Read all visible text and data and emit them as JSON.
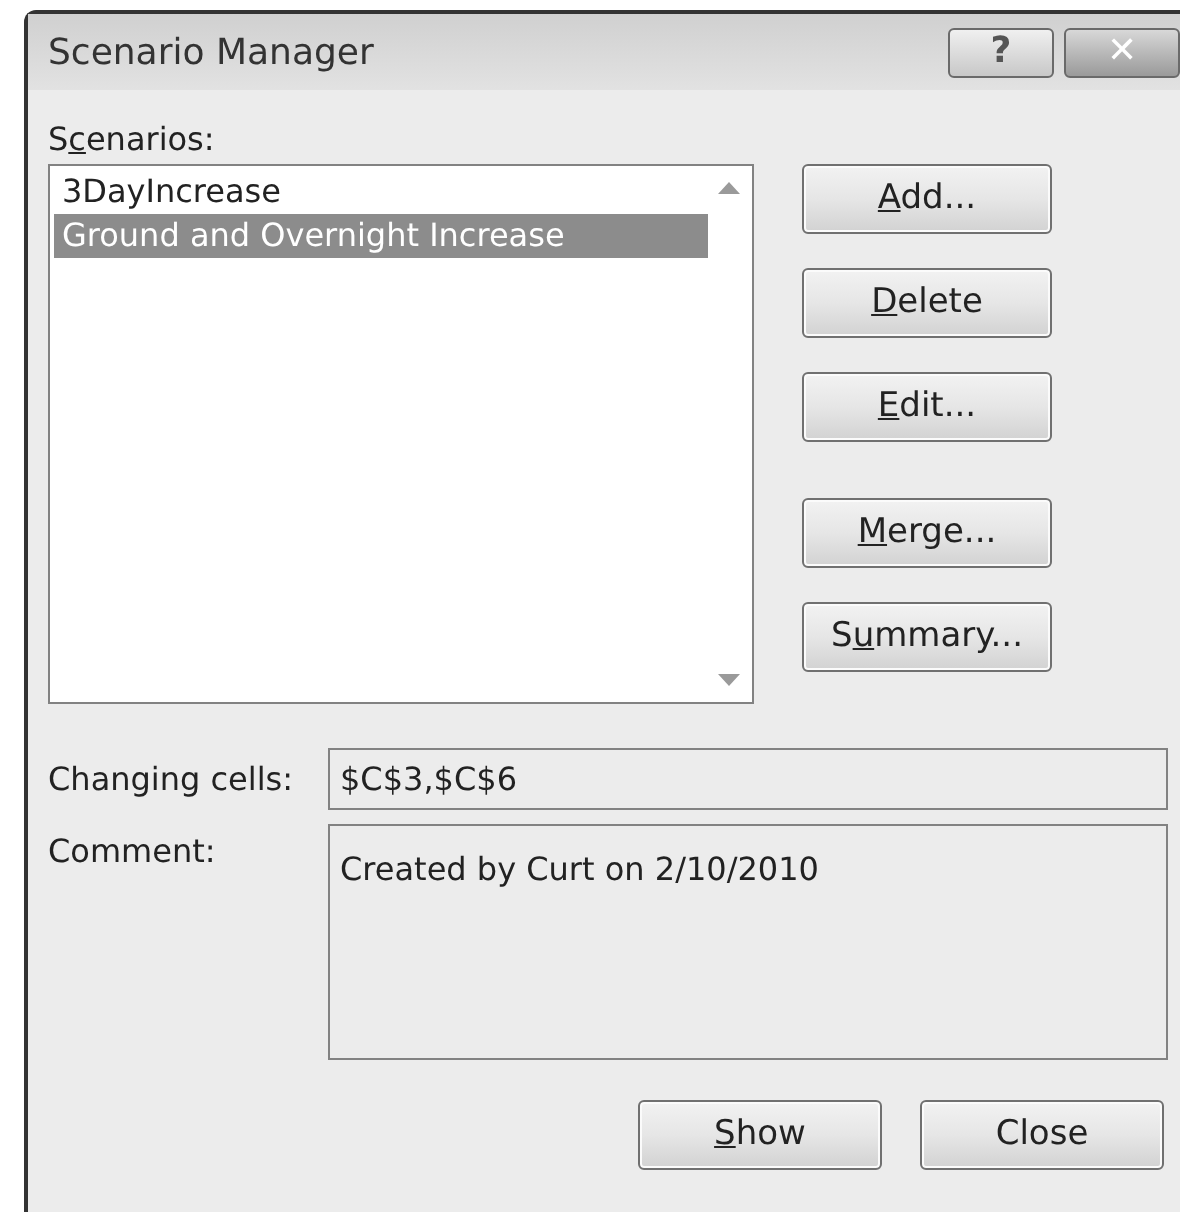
{
  "window": {
    "title": "Scenario Manager",
    "title_buttons": [
      {
        "kind": "help",
        "label": "?"
      },
      {
        "kind": "close",
        "label": "✕"
      }
    ]
  },
  "scenarios": {
    "label": {
      "pre": "S",
      "key": "c",
      "post": "enarios:"
    },
    "items": [
      {
        "label": "3DayIncrease",
        "selected": false
      },
      {
        "label": "Ground and Overnight Increase",
        "selected": true
      }
    ]
  },
  "side_buttons": [
    {
      "key": "A",
      "post": "dd..."
    },
    {
      "key": "D",
      "post": "elete"
    },
    {
      "key": "E",
      "post": "dit..."
    },
    {
      "key": "M",
      "post": "erge..."
    },
    {
      "pre": "S",
      "key": "u",
      "post": "mmary..."
    }
  ],
  "changing_cells": {
    "label": "Changing cells:",
    "value": "$C$3,$C$6"
  },
  "comment": {
    "label": "Comment:",
    "value": "Created by Curt on 2/10/2010"
  },
  "bottom_buttons": [
    {
      "key": "S",
      "post": "how"
    },
    {
      "pre": "Close"
    }
  ]
}
